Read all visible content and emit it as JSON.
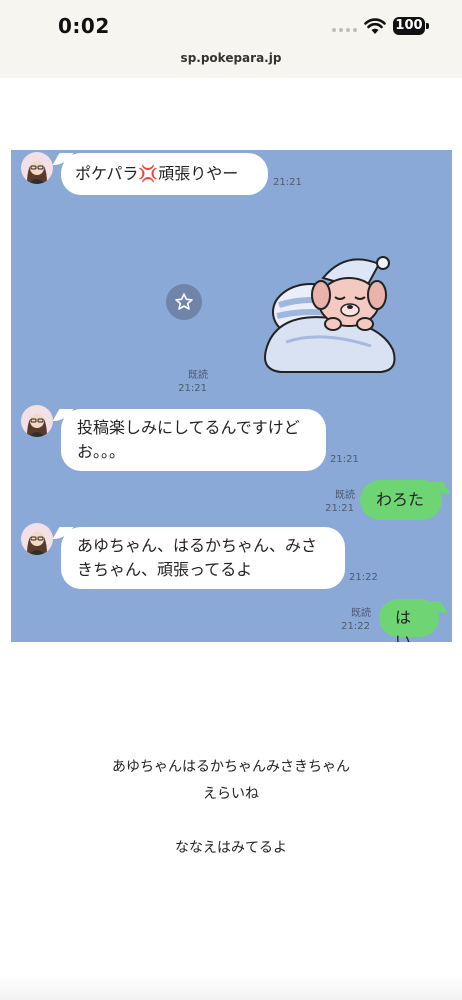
{
  "status_bar": {
    "time": "0:02",
    "battery": "100",
    "url": "sp.pokepara.jp"
  },
  "chat": {
    "messages": [
      {
        "side": "left",
        "text": "ポケパラ💢頑張りやー",
        "time": "21:21"
      },
      {
        "side": "right",
        "type": "sticker",
        "sticker": "sleeping-dog-sticker",
        "read": "既読",
        "time": "21:21"
      },
      {
        "side": "left",
        "text": "投稿楽しみにしてるんですけどお。。。",
        "time": "21:21"
      },
      {
        "side": "right",
        "text": "わろた",
        "read": "既読",
        "time": "21:21"
      },
      {
        "side": "left",
        "text": "あゆちゃん、はるかちゃん、みさきちゃん、頑張ってるよ",
        "time": "21:22"
      },
      {
        "side": "right",
        "text": "はい",
        "read": "既読",
        "time": "21:22"
      }
    ]
  },
  "caption": {
    "line1": "あゆちゃんはるかちゃんみさきちゃん",
    "line2": "えらいね",
    "line3": "ななえはみてるよ"
  },
  "colors": {
    "chat_background": "#8aa9d6",
    "outgoing_bubble": "#6fd574",
    "incoming_bubble": "#ffffff"
  }
}
